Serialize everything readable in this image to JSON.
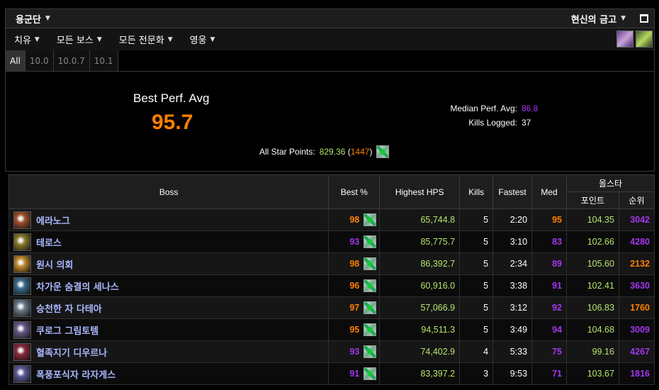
{
  "header": {
    "title": "용군단",
    "vault": "현신의 금고"
  },
  "menu": [
    "치유",
    "모든 보스",
    "모든 전문화",
    "영웅"
  ],
  "menu_icons": [
    "hall-icon",
    "key-icon"
  ],
  "tabs": [
    "All",
    "10.0",
    "10.0.7",
    "10.1"
  ],
  "active_tab": "All",
  "summary": {
    "best_label": "Best Perf. Avg",
    "best_value": "95.7",
    "median_label": "Median Perf. Avg:",
    "median_value": "86.8",
    "kills_label": "Kills Logged:",
    "kills_value": "37",
    "star_label": "All Star Points:",
    "star_points": "829.36",
    "star_open": " (",
    "star_rank": "1447",
    "star_close": ")"
  },
  "table": {
    "headers": {
      "boss": "Boss",
      "best": "Best %",
      "hps": "Highest HPS",
      "kills": "Kills",
      "fastest": "Fastest",
      "med": "Med",
      "allstar": "올스타",
      "points": "포인트",
      "rank": "순위"
    },
    "rows": [
      {
        "name": "에라노그",
        "best": "98",
        "hps": "65,744.8",
        "kills": "5",
        "fastest": "2:20",
        "med": "95",
        "points": "104.35",
        "rank": "3042"
      },
      {
        "name": "테로스",
        "best": "93",
        "hps": "85,775.7",
        "kills": "5",
        "fastest": "3:10",
        "med": "83",
        "points": "102.66",
        "rank": "4280"
      },
      {
        "name": "원시 의회",
        "best": "98",
        "hps": "86,392.7",
        "kills": "5",
        "fastest": "2:34",
        "med": "89",
        "points": "105.60",
        "rank": "2132"
      },
      {
        "name": "차가운 숨결의 세나스",
        "best": "96",
        "hps": "60,916.0",
        "kills": "5",
        "fastest": "3:38",
        "med": "91",
        "points": "102.41",
        "rank": "3630"
      },
      {
        "name": "승천한 자 다테아",
        "best": "97",
        "hps": "57,066.9",
        "kills": "5",
        "fastest": "3:12",
        "med": "92",
        "points": "106.83",
        "rank": "1760"
      },
      {
        "name": "쿠로그 그림토템",
        "best": "95",
        "hps": "94,511.3",
        "kills": "5",
        "fastest": "3:49",
        "med": "94",
        "points": "104.68",
        "rank": "3009"
      },
      {
        "name": "혈족지기 디우르나",
        "best": "93",
        "hps": "74,402.9",
        "kills": "4",
        "fastest": "5:33",
        "med": "75",
        "points": "99.16",
        "rank": "4267"
      },
      {
        "name": "폭풍포식자 라자게스",
        "best": "91",
        "hps": "83,397.2",
        "kills": "3",
        "fastest": "9:53",
        "med": "71",
        "points": "103.67",
        "rank": "1816"
      }
    ]
  },
  "colors": {
    "orange": "#ff8000",
    "purple": "#a335ee",
    "green": "#b5e46c",
    "boss_name": "#aab8ff",
    "boss_icons": [
      "#a0522d",
      "#8a7a2a",
      "#c08a2a",
      "#3a6a8a",
      "#6a7a8a",
      "#6a5a8a",
      "#8a2a3a",
      "#5a5a9a"
    ],
    "best": [
      "orange",
      "purple",
      "orange",
      "orange",
      "orange",
      "orange",
      "purple",
      "purple"
    ],
    "med": [
      "orange",
      "purple",
      "purple",
      "purple",
      "purple",
      "purple",
      "purple",
      "purple"
    ],
    "rank": [
      "purple",
      "purple",
      "orange",
      "purple",
      "orange",
      "purple",
      "purple",
      "purple"
    ]
  }
}
